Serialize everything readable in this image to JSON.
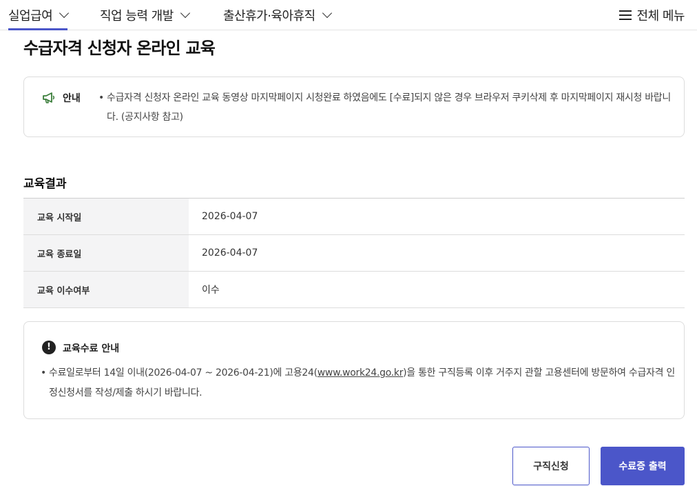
{
  "nav": {
    "items": [
      {
        "label": "실업급여",
        "active": true
      },
      {
        "label": "직업 능력 개발",
        "active": false
      },
      {
        "label": "출산휴가·육아휴직",
        "active": false
      }
    ],
    "all_menu_label": "전체 메뉴"
  },
  "page": {
    "title": "수급자격 신청자 온라인 교육"
  },
  "notice": {
    "label": "안내",
    "text": "수급자격 신청자 온라인 교육 동영상 마지막페이지 시청완료 하였음에도 [수료]되지 않은 경우 브라우저 쿠키삭제 후 마지막페이지 재시청 바랍니다. (공지사항 참고)"
  },
  "result": {
    "title": "교육결과",
    "rows": [
      {
        "label": "교육 시작일",
        "value": "2026-04-07"
      },
      {
        "label": "교육 종료일",
        "value": "2026-04-07"
      },
      {
        "label": "교육 이수여부",
        "value": "이수"
      }
    ]
  },
  "completion": {
    "heading": "교육수료 안내",
    "text_before": "수료일로부터 14일 이내(2026-04-07 ~ 2026-04-21)에 고용24(",
    "link": "www.work24.go.kr",
    "text_after": ")을 통한 구직등록 이후 거주지 관할 고용센터에 방문하여 수급자격 인정신청서를 작성/제출 하시기 바랍니다."
  },
  "buttons": {
    "job_apply": "구직신청",
    "print_certificate": "수료증 출력"
  },
  "colors": {
    "accent": "#4b56c9",
    "notice_icon": "#3a7d3a"
  }
}
